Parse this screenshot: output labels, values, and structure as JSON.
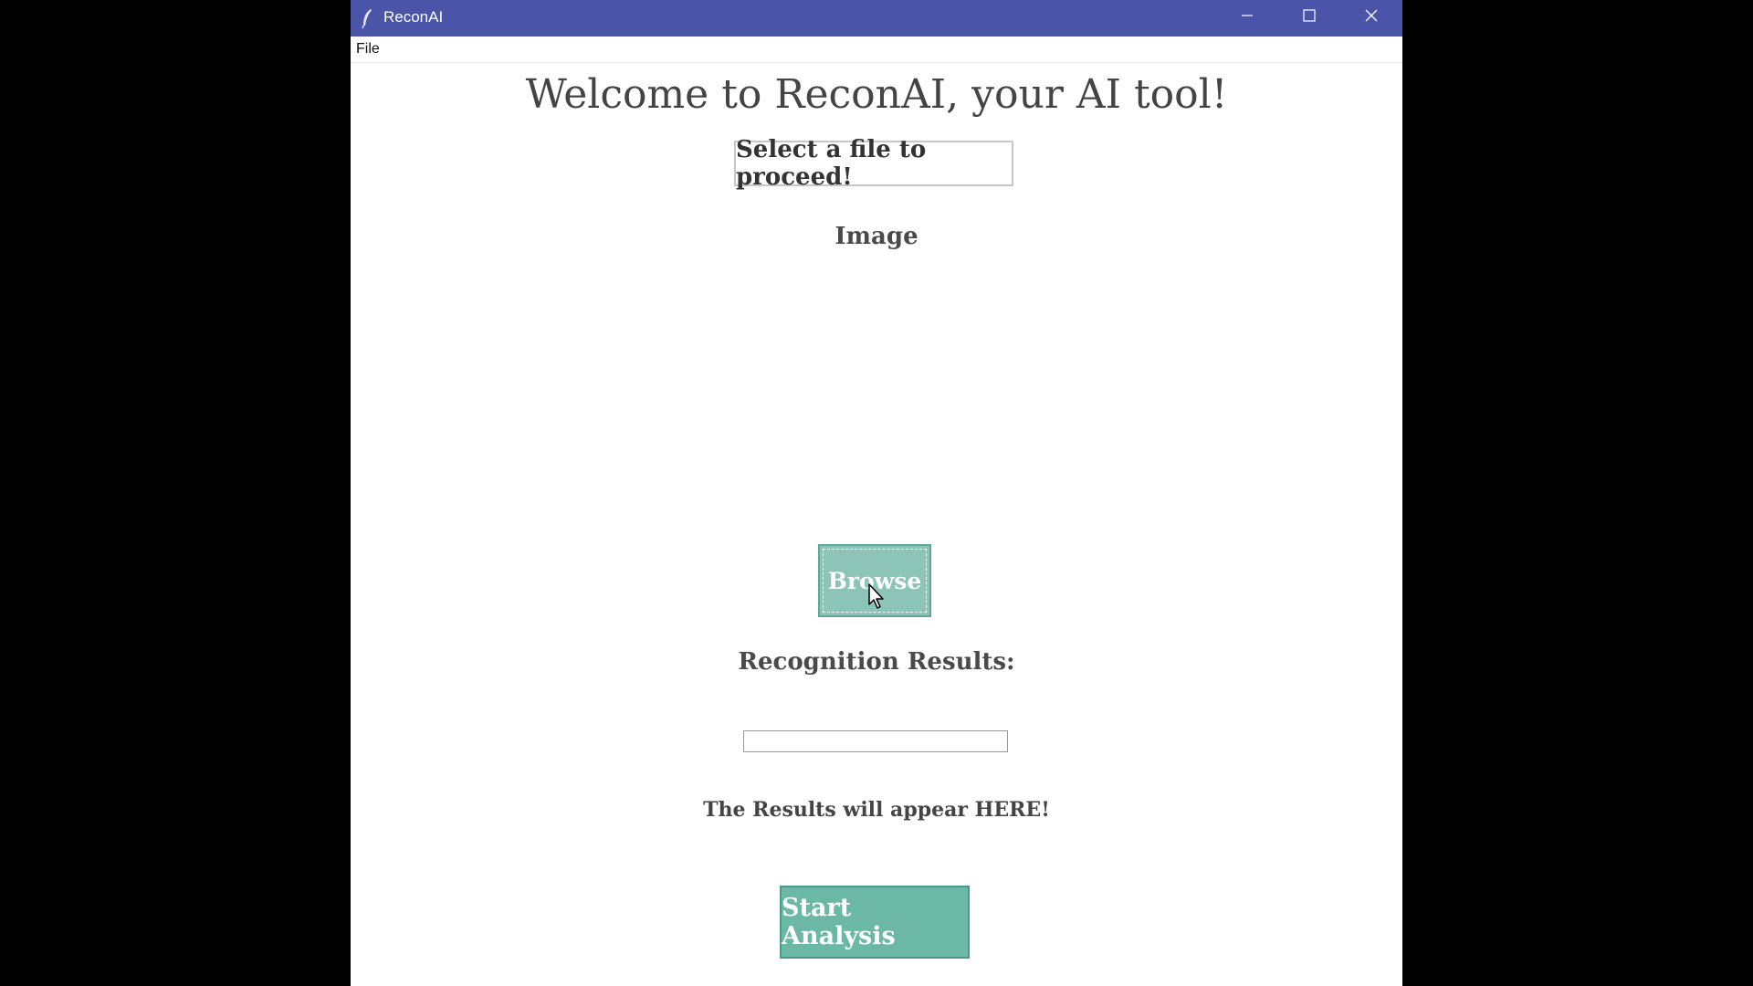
{
  "window": {
    "title": "ReconAI",
    "app_icon": "feather-icon",
    "controls": {
      "minimize_icon": "minimize-icon",
      "maximize_icon": "maximize-icon",
      "close_icon": "close-icon"
    }
  },
  "menubar": {
    "items": [
      {
        "label": "File"
      }
    ]
  },
  "main": {
    "heading": "Welcome to ReconAI, your AI tool!",
    "prompt": "Select a file to proceed!",
    "image_label": "Image",
    "browse_label": "Browse",
    "results_heading": "Recognition Results:",
    "progress_value": 0,
    "results_text": "The Results will appear HERE!",
    "start_label": "Start Analysis"
  },
  "colors": {
    "titlebar": "#4a54a8",
    "browse_button": "#8cc5b8",
    "start_button": "#6cb8a6",
    "background": "#ffffff"
  }
}
